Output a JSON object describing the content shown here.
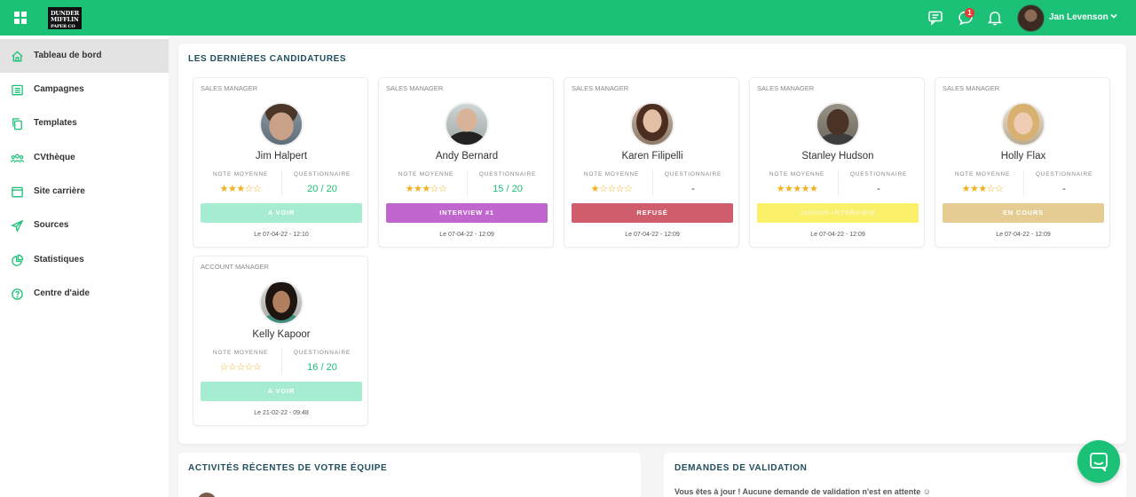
{
  "brand": {
    "logo_text": "DUNDER MIFFLIN",
    "accent": "#1bc176"
  },
  "topbar": {
    "notification_count": "1",
    "user_name": "Jan Levenson"
  },
  "sidebar": {
    "items": [
      {
        "label": "Tableau de bord",
        "icon": "home-icon"
      },
      {
        "label": "Campagnes",
        "icon": "list-icon"
      },
      {
        "label": "Templates",
        "icon": "copy-icon"
      },
      {
        "label": "CVthèque",
        "icon": "users-icon"
      },
      {
        "label": "Site carrière",
        "icon": "window-icon"
      },
      {
        "label": "Sources",
        "icon": "send-icon"
      },
      {
        "label": "Statistiques",
        "icon": "pie-chart-icon"
      },
      {
        "label": "Centre d'aide",
        "icon": "help-icon"
      }
    ]
  },
  "main": {
    "title": "LES DERNIÈRES CANDIDATURES",
    "rating_label": "NOTE MOYENNE",
    "questionnaire_label": "QUESTIONNAIRE",
    "cards": [
      {
        "role": "SALES MANAGER",
        "name": "Jim Halpert",
        "rating": 3,
        "stars": "★★★☆☆",
        "score": "20 / 20",
        "status": "A VOIR",
        "status_color": "#a6ecd0",
        "date": "Le 07-04-22 - 12:10"
      },
      {
        "role": "SALES MANAGER",
        "name": "Andy Bernard",
        "rating": 3,
        "stars": "★★★☆☆",
        "score": "15 / 20",
        "status": "INTERVIEW #1",
        "status_color": "#c266cf",
        "date": "Le 07-04-22 - 12:09"
      },
      {
        "role": "SALES MANAGER",
        "name": "Karen Filipelli",
        "rating": 1,
        "stars": "★☆☆☆☆",
        "score": "-",
        "status": "REFUSÉ",
        "status_color": "#d05d6b",
        "date": "Le 07-04-22 - 12:09"
      },
      {
        "role": "SALES MANAGER",
        "name": "Stanley Hudson",
        "rating": 5,
        "stars": "★★★★★",
        "score": "-",
        "status": "JUNIOR INTERVIEW",
        "status_color": "#fbf06a",
        "date": "Le 07-04-22 - 12:09"
      },
      {
        "role": "SALES MANAGER",
        "name": "Holly Flax",
        "rating": 3,
        "stars": "★★★☆☆",
        "score": "-",
        "status": "EN COURS",
        "status_color": "#e4cc92",
        "date": "Le 07-04-22 - 12:09"
      },
      {
        "role": "ACCOUNT MANAGER",
        "name": "Kelly Kapoor",
        "rating": 0,
        "stars": "☆☆☆☆☆",
        "score": "16 / 20",
        "status": "A VOIR",
        "status_color": "#a6ecd0",
        "date": "Le 21-02-22 - 09:48"
      }
    ]
  },
  "activity": {
    "title": "ACTIVITÉS RÉCENTES DE VOTRE ÉQUIPE"
  },
  "validation": {
    "title": "DEMANDES DE VALIDATION",
    "message": "Vous êtes à jour ! Aucune demande de validation n'est en attente ☺"
  }
}
